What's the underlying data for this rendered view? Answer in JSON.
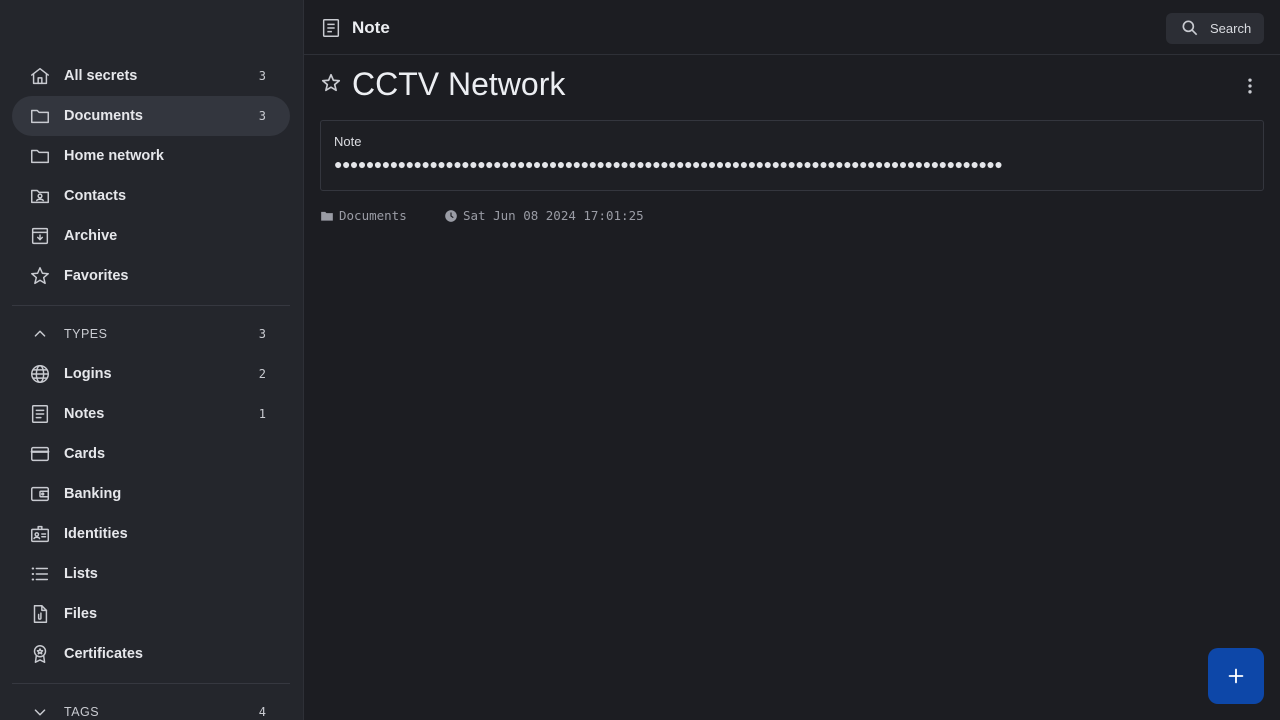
{
  "sidebar": {
    "items": [
      {
        "label": "All secrets",
        "count": "3",
        "icon": "home-icon"
      },
      {
        "label": "Documents",
        "count": "3",
        "icon": "folder-icon",
        "active": true
      },
      {
        "label": "Home network",
        "count": "",
        "icon": "folder-icon"
      },
      {
        "label": "Contacts",
        "count": "",
        "icon": "folder-contacts-icon"
      },
      {
        "label": "Archive",
        "count": "",
        "icon": "archive-icon"
      },
      {
        "label": "Favorites",
        "count": "",
        "icon": "star-icon"
      }
    ],
    "types_header": {
      "label": "TYPES",
      "count": "3"
    },
    "types": [
      {
        "label": "Logins",
        "count": "2",
        "icon": "globe-icon"
      },
      {
        "label": "Notes",
        "count": "1",
        "icon": "note-icon"
      },
      {
        "label": "Cards",
        "count": "",
        "icon": "card-icon"
      },
      {
        "label": "Banking",
        "count": "",
        "icon": "wallet-icon"
      },
      {
        "label": "Identities",
        "count": "",
        "icon": "id-badge-icon"
      },
      {
        "label": "Lists",
        "count": "",
        "icon": "list-icon"
      },
      {
        "label": "Files",
        "count": "",
        "icon": "file-icon"
      },
      {
        "label": "Certificates",
        "count": "",
        "icon": "certificate-icon"
      }
    ],
    "tags_header": {
      "label": "TAGS",
      "count": "4"
    }
  },
  "topbar": {
    "title": "Note",
    "search_label": "Search"
  },
  "secret": {
    "title": "CCTV Network",
    "field_label": "Note",
    "field_value": "●●●●●●●●●●●●●●●●●●●●●●●●●●●●●●●●●●●●●●●●●●●●●●●●●●●●●●●●●●●●●●●●●●●●●●●●●●●●●●●●●●●●",
    "folder": "Documents",
    "timestamp": "Sat Jun 08 2024 17:01:25"
  },
  "colors": {
    "sidebar_bg": "#24262c",
    "main_bg": "#1c1d22",
    "active_item_bg": "#33363e",
    "fab_bg": "#0d47a8"
  }
}
